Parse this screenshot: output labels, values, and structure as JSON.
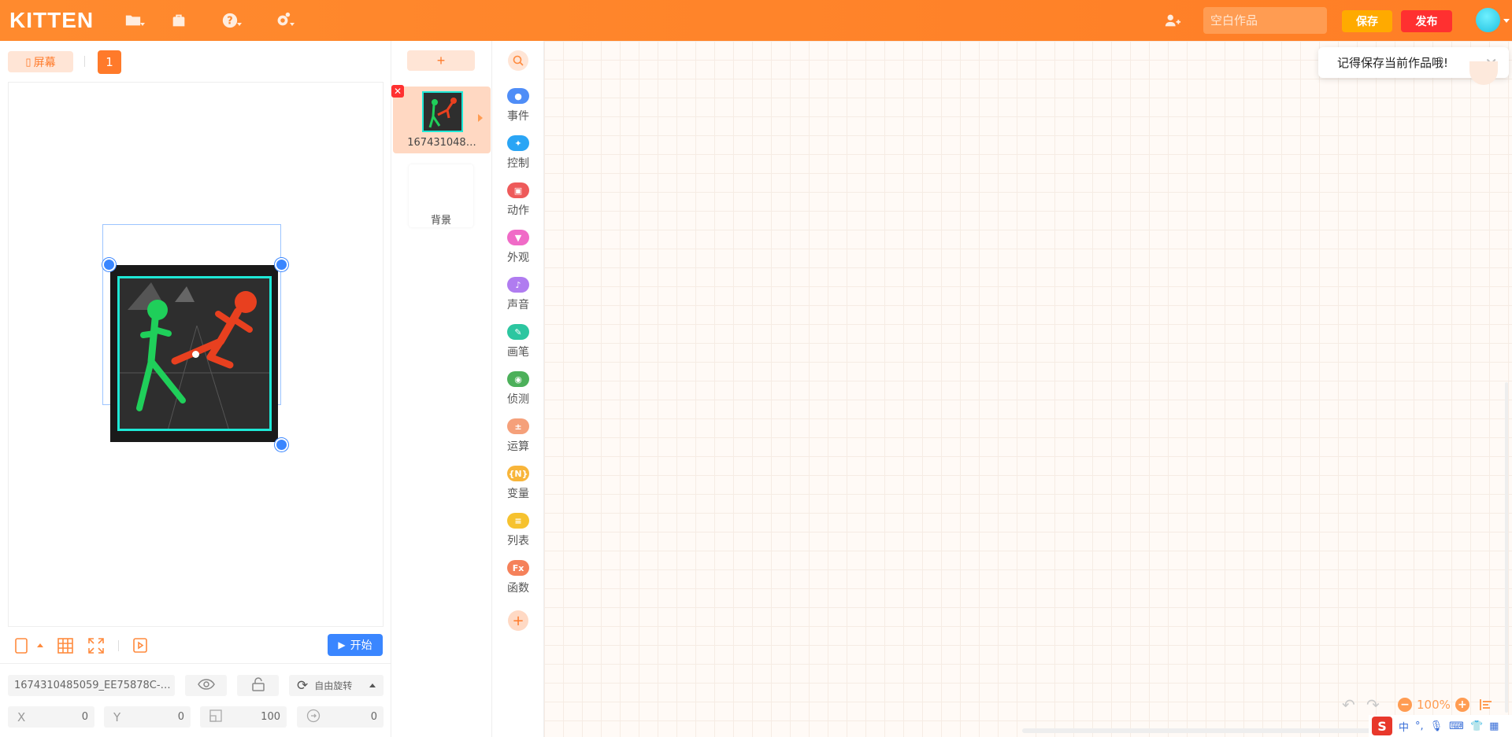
{
  "app": {
    "logo": "KITTEN",
    "title_placeholder": "空白作品",
    "save_label": "保存",
    "publish_label": "发布"
  },
  "stage": {
    "screen_button": "屏幕",
    "screen_number": "1",
    "start_label": "开始"
  },
  "sprite_props": {
    "name": "1674310485059_EE75878C-…",
    "rotation_mode": "自由旋转",
    "x_label": "X",
    "x": "0",
    "y_label": "Y",
    "y": "0",
    "size": "100",
    "direction": "0"
  },
  "sprites": {
    "add_label": "+",
    "items": [
      {
        "name": "167431048…"
      }
    ],
    "background_label": "背景"
  },
  "categories": [
    {
      "label": "事件",
      "color": "#4f8df7",
      "icon": "toggle-icon"
    },
    {
      "label": "控制",
      "color": "#2aa5f5",
      "icon": "gamepad-icon"
    },
    {
      "label": "动作",
      "color": "#ee5a5a",
      "icon": "robot-icon"
    },
    {
      "label": "外观",
      "color": "#f06bc7",
      "icon": "shirt-icon"
    },
    {
      "label": "声音",
      "color": "#b07cf0",
      "icon": "music-icon"
    },
    {
      "label": "画笔",
      "color": "#2cc6a0",
      "icon": "brush-icon"
    },
    {
      "label": "侦测",
      "color": "#4cb05a",
      "icon": "radar-icon"
    },
    {
      "label": "运算",
      "color": "#f5a07a",
      "icon": "math-icon"
    },
    {
      "label": "变量",
      "color": "#f8b53a",
      "icon": "variable-icon"
    },
    {
      "label": "列表",
      "color": "#f6c22f",
      "icon": "list-icon"
    },
    {
      "label": "函数",
      "color": "#f5815a",
      "icon": "function-icon"
    }
  ],
  "workspace": {
    "toast": "记得保存当前作品哦!",
    "zoom": "100%"
  },
  "ime": {
    "logo": "S",
    "mode": "中"
  }
}
